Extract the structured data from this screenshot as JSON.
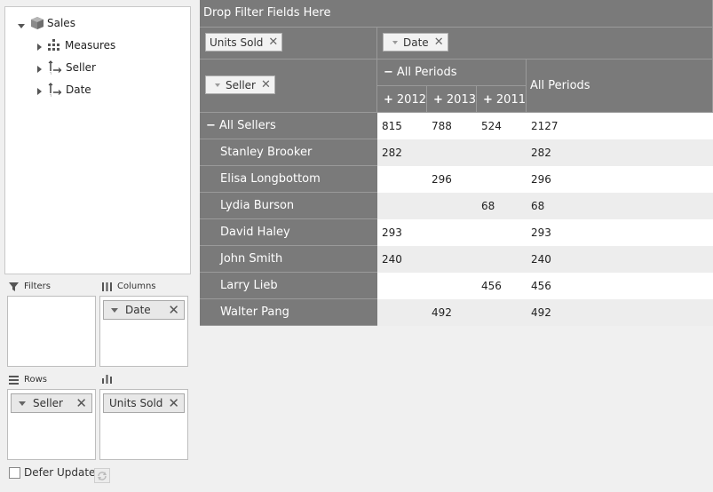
{
  "tree": {
    "root_label": "Sales",
    "items": [
      {
        "label": "Measures",
        "icon": "measures-icon"
      },
      {
        "label": "Seller",
        "icon": "dimension-icon"
      },
      {
        "label": "Date",
        "icon": "dimension-icon"
      }
    ]
  },
  "areas": {
    "filters_label": "Filters",
    "columns_label": "Columns",
    "rows_label": "Rows",
    "values_label": "",
    "columns_field": "Date",
    "rows_field": "Seller",
    "values_field": "Units Sold"
  },
  "defer_update_label": "Defer Update",
  "grid": {
    "drop_filter_text": "Drop Filter Fields Here",
    "data_field_chip": "Units Sold",
    "column_field_chip": "Date",
    "row_field_chip": "Seller",
    "all_periods_label": "All Periods",
    "all_periods_total_label": "All Periods",
    "years": [
      "2012",
      "2013",
      "2011"
    ],
    "all_sellers_label": "All Sellers",
    "rows": [
      {
        "seller": "All Sellers",
        "y2012": "815",
        "y2013": "788",
        "y2011": "524",
        "total": "2127"
      },
      {
        "seller": "Stanley Brooker",
        "y2012": "282",
        "y2013": "",
        "y2011": "",
        "total": "282"
      },
      {
        "seller": "Elisa Longbottom",
        "y2012": "",
        "y2013": "296",
        "y2011": "",
        "total": "296"
      },
      {
        "seller": "Lydia Burson",
        "y2012": "",
        "y2013": "",
        "y2011": "68",
        "total": "68"
      },
      {
        "seller": "David Haley",
        "y2012": "293",
        "y2013": "",
        "y2011": "",
        "total": "293"
      },
      {
        "seller": "John Smith",
        "y2012": "240",
        "y2013": "",
        "y2011": "",
        "total": "240"
      },
      {
        "seller": "Larry Lieb",
        "y2012": "",
        "y2013": "",
        "y2011": "456",
        "total": "456"
      },
      {
        "seller": "Walter Pang",
        "y2012": "",
        "y2013": "492",
        "y2011": "",
        "total": "492"
      }
    ]
  },
  "colors": {
    "header_bg": "#7a7a7a",
    "row_alt_bg": "#ededed",
    "page_bg": "#f0f0f0"
  }
}
